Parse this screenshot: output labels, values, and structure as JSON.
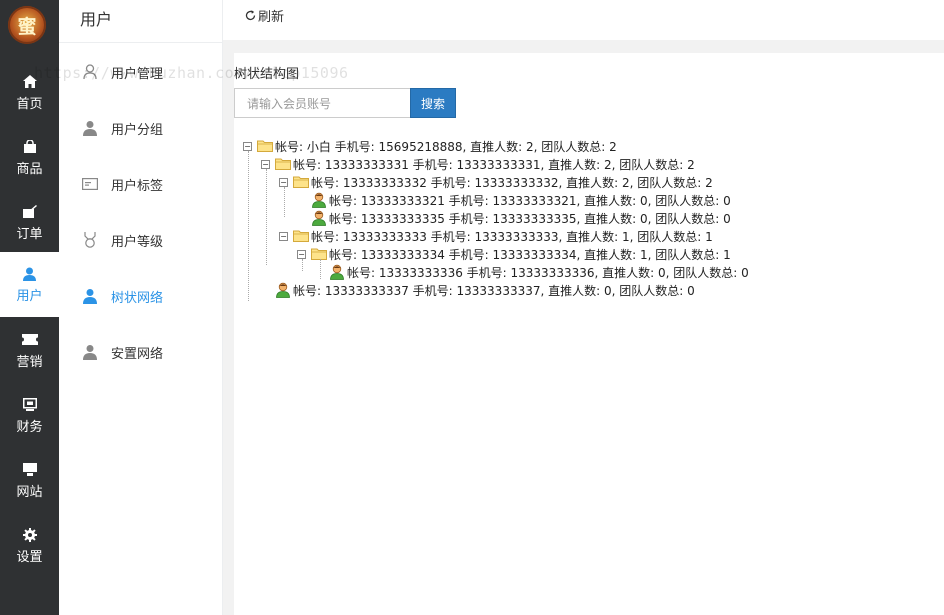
{
  "logo": {
    "text": "蜜"
  },
  "nav": {
    "items": [
      {
        "label": "首页",
        "icon": "home-icon"
      },
      {
        "label": "商品",
        "icon": "bag-icon"
      },
      {
        "label": "订单",
        "icon": "order-icon"
      },
      {
        "label": "用户",
        "icon": "user-icon",
        "active": true
      },
      {
        "label": "营销",
        "icon": "ticket-icon"
      },
      {
        "label": "财务",
        "icon": "finance-icon"
      },
      {
        "label": "网站",
        "icon": "monitor-icon"
      },
      {
        "label": "设置",
        "icon": "gear-icon"
      }
    ]
  },
  "submenu": {
    "title": "用户",
    "items": [
      {
        "label": "用户管理",
        "icon": "user-outline-icon"
      },
      {
        "label": "用户分组",
        "icon": "user-group-icon"
      },
      {
        "label": "用户标签",
        "icon": "id-card-icon"
      },
      {
        "label": "用户等级",
        "icon": "medal-icon"
      },
      {
        "label": "树状网络",
        "icon": "user-tree-icon",
        "active": true
      },
      {
        "label": "安置网络",
        "icon": "user-placement-icon"
      }
    ]
  },
  "topbar": {
    "refresh_label": "刷新"
  },
  "panel": {
    "title": "树状结构图",
    "search_placeholder": "请输入会员账号",
    "search_button": "搜索"
  },
  "tree": [
    {
      "text": "帐号: 小白   手机号: 15695218888, 直推人数: 2, 团队人数总: 2",
      "level": 0,
      "type": "folder"
    },
    {
      "text": "帐号: 13333333331   手机号: 13333333331, 直推人数: 2, 团队人数总: 2",
      "level": 1,
      "type": "folder"
    },
    {
      "text": "帐号: 13333333332   手机号: 13333333332, 直推人数: 2, 团队人数总: 2",
      "level": 2,
      "type": "folder"
    },
    {
      "text": "帐号: 13333333321   手机号: 13333333321, 直推人数: 0, 团队人数总: 0",
      "level": 3,
      "type": "user"
    },
    {
      "text": "帐号: 13333333335   手机号: 13333333335, 直推人数: 0, 团队人数总: 0",
      "level": 3,
      "type": "user"
    },
    {
      "text": "帐号: 13333333333   手机号: 13333333333, 直推人数: 1, 团队人数总: 1",
      "level": 2,
      "type": "folder"
    },
    {
      "text": "帐号: 13333333334   手机号: 13333333334, 直推人数: 1, 团队人数总: 1",
      "level": 3,
      "type": "folder"
    },
    {
      "text": "帐号: 13333333336   手机号: 13333333336, 直推人数: 0, 团队人数总: 0",
      "level": 4,
      "type": "user"
    },
    {
      "text": "帐号: 13333333337   手机号: 13333333337, 直推人数: 0, 团队人数总: 0",
      "level": 1,
      "type": "user"
    }
  ],
  "watermark": "https://www.huzhan.com/ishop15096",
  "colors": {
    "accent": "#2b93e6",
    "nav_bg": "#2f3133",
    "button": "#2b7bc2"
  }
}
